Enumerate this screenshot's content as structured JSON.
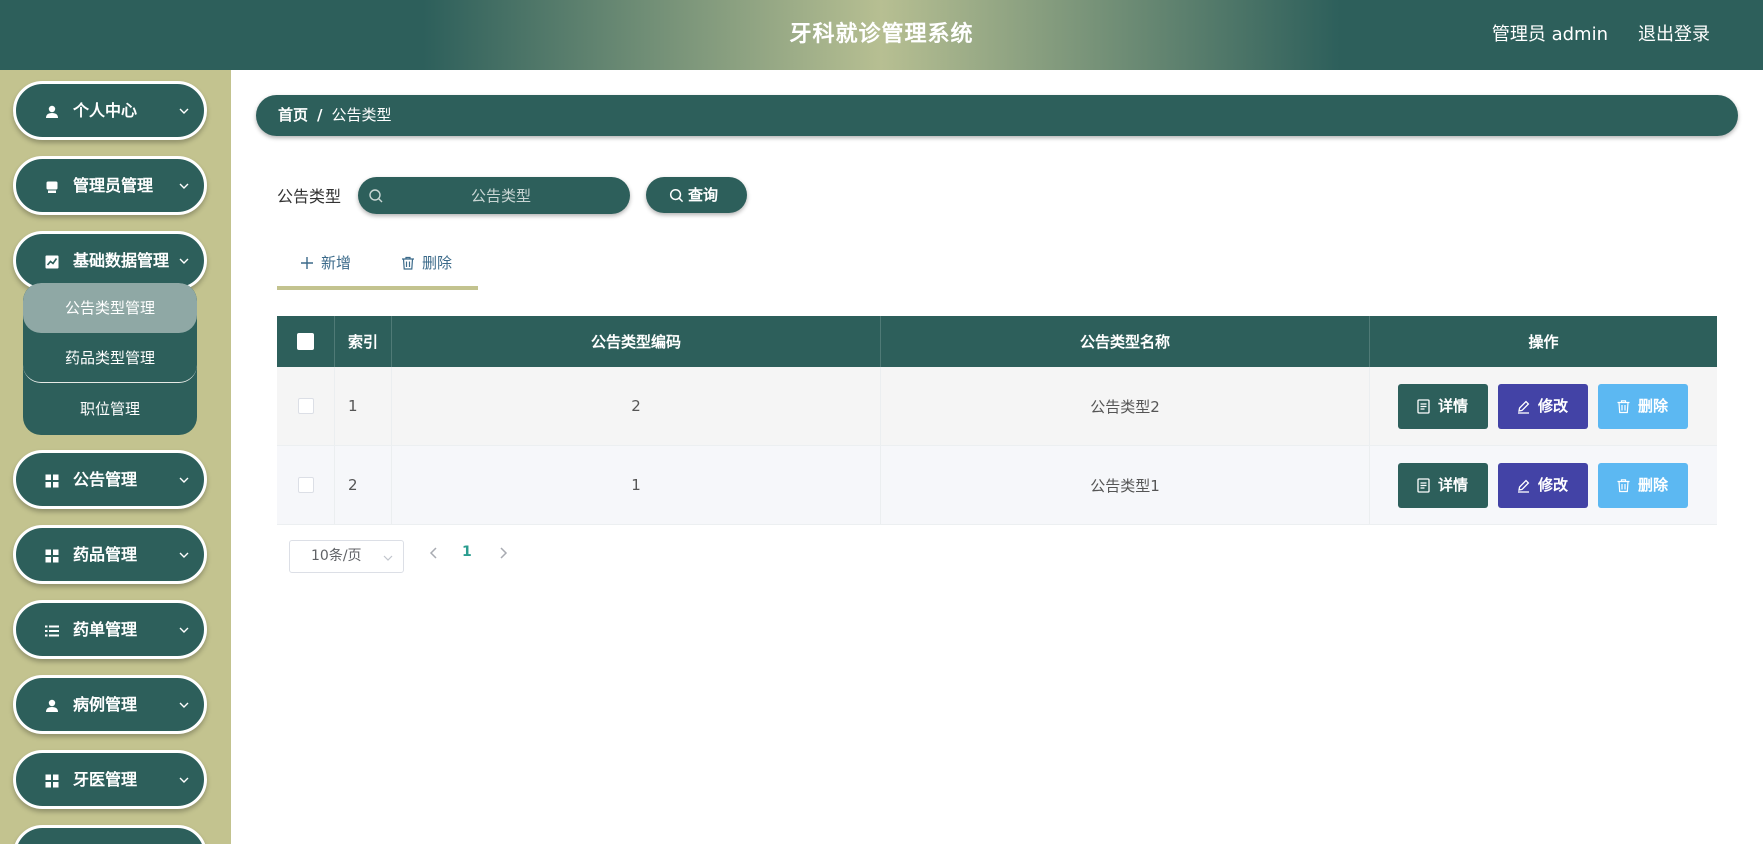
{
  "header": {
    "title": "牙科就诊管理系统",
    "user_label": "管理员 admin",
    "logout_label": "退出登录"
  },
  "sidebar": {
    "items": [
      {
        "label": "个人中心",
        "icon": "user-icon"
      },
      {
        "label": "管理员管理",
        "icon": "admin-icon"
      },
      {
        "label": "基础数据管理",
        "icon": "chart-icon"
      },
      {
        "label": "公告管理",
        "icon": "grid-icon"
      },
      {
        "label": "药品管理",
        "icon": "grid-icon"
      },
      {
        "label": "药单管理",
        "icon": "list-icon"
      },
      {
        "label": "病例管理",
        "icon": "user-icon"
      },
      {
        "label": "牙医管理",
        "icon": "grid-icon"
      }
    ],
    "submenu": [
      {
        "label": "公告类型管理",
        "active": true
      },
      {
        "label": "药品类型管理",
        "active": false
      },
      {
        "label": "职位管理",
        "active": false
      }
    ]
  },
  "breadcrumb": {
    "home": "首页",
    "separator": "/",
    "current": "公告类型"
  },
  "search": {
    "label": "公告类型",
    "placeholder": "公告类型",
    "button_label": "查询"
  },
  "toolbar": {
    "add_label": "新增",
    "delete_label": "删除"
  },
  "table": {
    "headers": {
      "index": "索引",
      "code": "公告类型编码",
      "name": "公告类型名称",
      "ops": "操作"
    },
    "rows": [
      {
        "index": "1",
        "code": "2",
        "name": "公告类型2"
      },
      {
        "index": "2",
        "code": "1",
        "name": "公告类型1"
      }
    ],
    "row_actions": {
      "detail": "详情",
      "edit": "修改",
      "delete": "删除"
    }
  },
  "pagination": {
    "page_size": "10条/页",
    "current_page": "1"
  },
  "colors": {
    "primary": "#2d5f5b",
    "sidebar_bg": "#c3c38f",
    "edit_button": "#4343a6",
    "delete_button": "#5cb8f2",
    "page_active": "#2a9d8f"
  }
}
